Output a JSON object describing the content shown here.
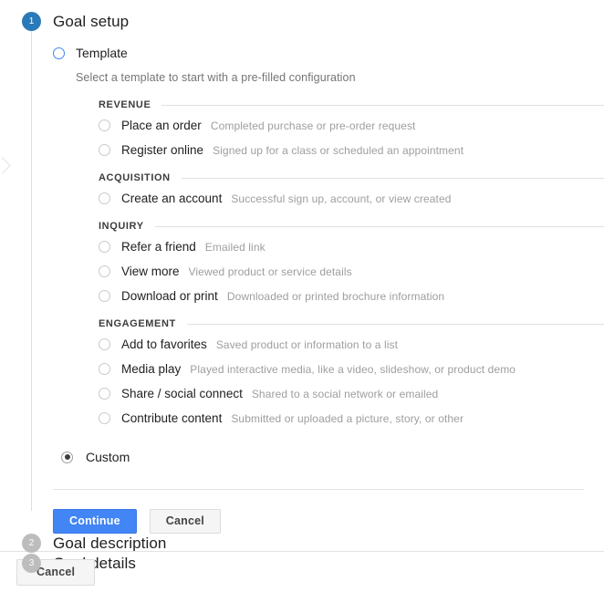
{
  "colors": {
    "active_step": "#2a7ab9",
    "inactive_step": "#bdbdbd",
    "primary_button": "#4285f4",
    "radio_highlight": "#4285f4",
    "divider": "#e3e3e3"
  },
  "steps": [
    {
      "number": "1",
      "title": "Goal setup",
      "state": "active"
    },
    {
      "number": "2",
      "title": "Goal description",
      "state": "inactive"
    },
    {
      "number": "3",
      "title": "Goal details",
      "state": "inactive"
    }
  ],
  "goal_setup": {
    "template_option": {
      "label": "Template",
      "selected": false,
      "description": "Select a template to start with a pre-filled configuration"
    },
    "custom_option": {
      "label": "Custom",
      "selected": true
    },
    "sections": [
      {
        "title": "REVENUE",
        "items": [
          {
            "label": "Place an order",
            "hint": "Completed purchase or pre-order request",
            "selected": false
          },
          {
            "label": "Register online",
            "hint": "Signed up for a class or scheduled an appointment",
            "selected": false
          }
        ]
      },
      {
        "title": "ACQUISITION",
        "items": [
          {
            "label": "Create an account",
            "hint": "Successful sign up, account, or view created",
            "selected": false
          }
        ]
      },
      {
        "title": "INQUIRY",
        "items": [
          {
            "label": "Refer a friend",
            "hint": "Emailed link",
            "selected": false
          },
          {
            "label": "View more",
            "hint": "Viewed product or service details",
            "selected": false
          },
          {
            "label": "Download or print",
            "hint": "Downloaded or printed brochure information",
            "selected": false
          }
        ]
      },
      {
        "title": "ENGAGEMENT",
        "items": [
          {
            "label": "Add to favorites",
            "hint": "Saved product or information to a list",
            "selected": false
          },
          {
            "label": "Media play",
            "hint": "Played interactive media, like a video, slideshow, or product demo",
            "selected": false
          },
          {
            "label": "Share / social connect",
            "hint": "Shared to a social network or emailed",
            "selected": false
          },
          {
            "label": "Contribute content",
            "hint": "Submitted or uploaded a picture, story, or other",
            "selected": false
          }
        ]
      }
    ],
    "actions": {
      "continue_label": "Continue",
      "cancel_label": "Cancel"
    }
  },
  "footer": {
    "cancel_label": "Cancel"
  }
}
